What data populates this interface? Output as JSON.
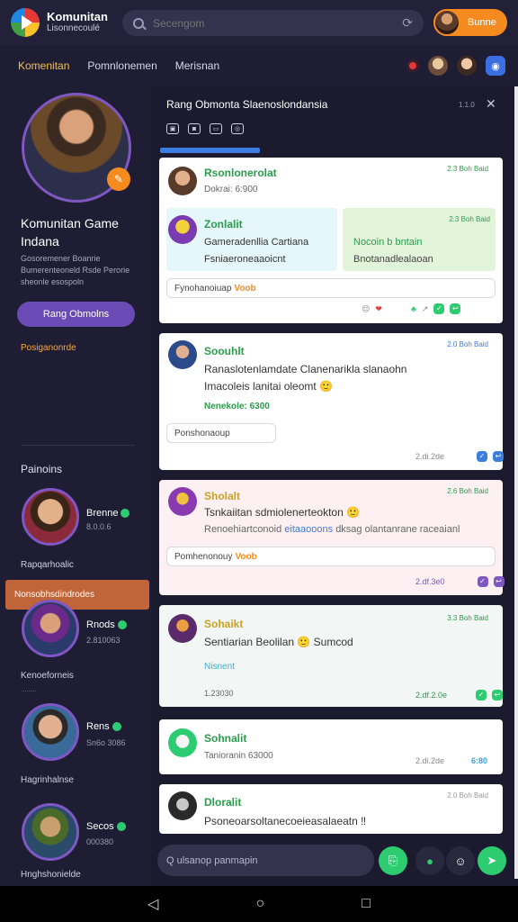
{
  "topbar": {
    "brand_title": "Komunitan",
    "brand_sub": "Lisonnecoulé",
    "search_placeholder": "Secengom",
    "profile_button": "Bunne"
  },
  "nav": {
    "tabs": [
      "Komenitan",
      "Pomnlonemen",
      "Merisnan"
    ]
  },
  "sidebar": {
    "profile_name": "Komunitan Game Indana",
    "profile_desc": "Gosoremener Boanrie Bumerenteoneld Rsde Perorie sheonle esospoln",
    "profile_button": "Rang Obmolns",
    "profile_link": "Posiganonrde",
    "section_head": "Painoins",
    "members": [
      {
        "name": "Brenne",
        "stat": "8.0.0.6",
        "label": "Rapqarhoalic",
        "sub": ""
      },
      {
        "name": "Rnods",
        "stat": "2.810063",
        "label": "Kenoeforneis",
        "sub": "........"
      },
      {
        "name": "Rens",
        "stat": "Sn6o 3086",
        "label": "Hagrinhalnse",
        "sub": ""
      },
      {
        "name": "Secos",
        "stat": "000380",
        "label": "Hnghshonielde",
        "sub": ""
      }
    ],
    "highlight": "Nonsobhsdindrodes"
  },
  "room": {
    "title": "Rang Obmonta Slaenoslondansia",
    "meta": "1.1.0",
    "tools": [
      "▣",
      "◙",
      "▭",
      "◎"
    ]
  },
  "messages": [
    {
      "name": "Rsonlonerolat",
      "time": "2.3 Boh Baid",
      "text": "Dokrai: 6:900",
      "sub1_name": "Zonlalit",
      "sub1_text1": "Gameradenllia Cartiana",
      "sub1_text2": "Fsniaeroneaaoicnt",
      "sub2_time": "2.3 Boh Baid",
      "sub2_text1": "Nocoin b bntain",
      "sub2_text2": "Bnotanadlealaoan",
      "reply": "Fynohanoiuap",
      "reply_tag": "Voob"
    },
    {
      "name": "Soouhlt",
      "time": "2.0 Boh Baid",
      "text1": "Ranaslotenlamdate Clanenarikla slanaohn",
      "text2": "Imacoleis lanitai oleomt 🙂",
      "link": "Nenekole: 6300",
      "reply": "Ponshonaoup",
      "meta": "2.di.2de"
    },
    {
      "name": "Sholalt",
      "time": "2.6 Boh Baid",
      "text1": "Tsnkaiitan sdmiolenerteokton 🙂",
      "text2a": "Renoehiartconoid",
      "text2b": "eitaaooons",
      "text2c": "dksag olantanrane raceaianl",
      "reply": "Pomhenonouy",
      "reply_tag": "Voob",
      "meta": "2.df.3e0"
    },
    {
      "name": "Sohaikt",
      "time": "3.3 Boh Baid",
      "text": "Sentiarian Beolilan 🙂 Sumcod",
      "link": "Nisnent",
      "stat": "1.23030",
      "meta": "2.df.2.0e"
    },
    {
      "name": "Sohnalit",
      "time": "",
      "text": "Tanioranin 63000",
      "meta": "2.di.2de",
      "meta2": "6:80"
    },
    {
      "name": "Dloralit",
      "time": "2.0 Boh Baid",
      "text": "Psoneoarsoltanecoeieasalaeatn ‼"
    }
  ],
  "composer": {
    "placeholder": "Q ulsanop panmapin"
  },
  "colors": {
    "accent_orange": "#f58b1f",
    "accent_green": "#2ecc71",
    "accent_purple": "#7e57c2",
    "accent_blue": "#3b7de0"
  }
}
